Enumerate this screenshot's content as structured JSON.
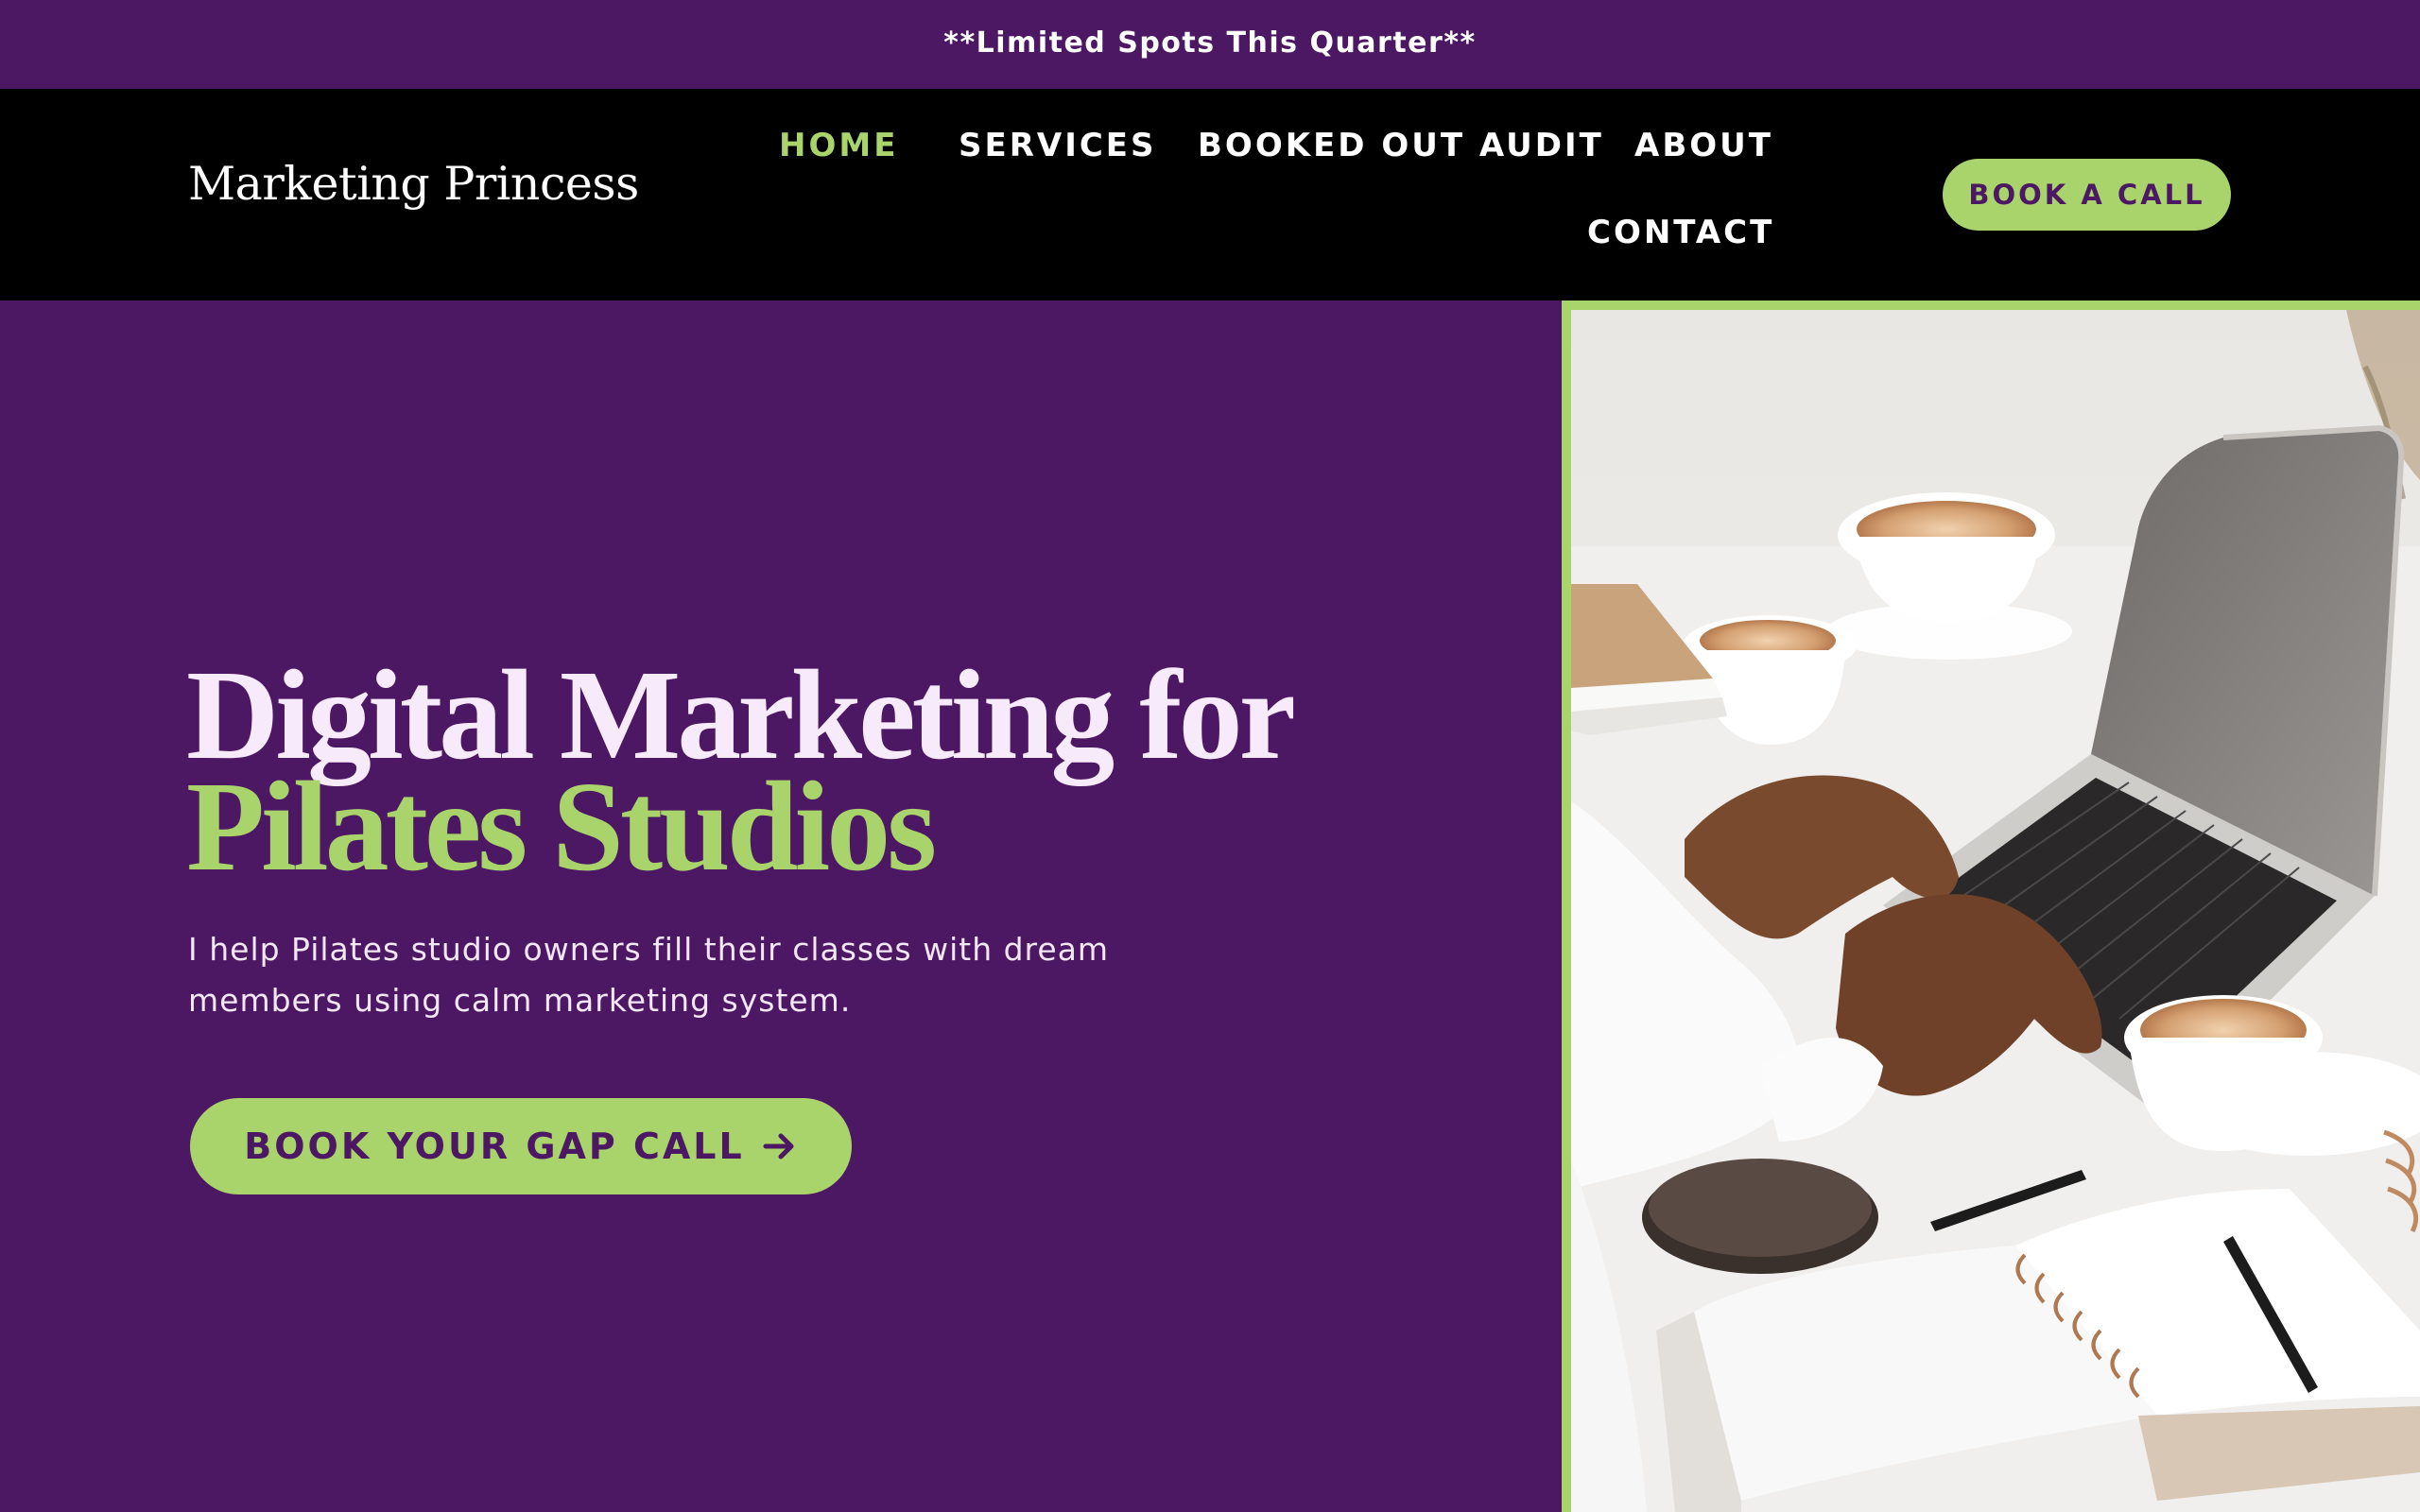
{
  "announcement": {
    "text": "**Limited Spots This Quarter**"
  },
  "header": {
    "logo": "Marketing Princess",
    "nav": [
      {
        "label": "HOME",
        "active": true
      },
      {
        "label": "SERVICES",
        "active": false
      },
      {
        "label": "BOOKED OUT AUDIT",
        "active": false
      },
      {
        "label": "ABOUT",
        "active": false
      },
      {
        "label": "CONTACT",
        "active": false
      }
    ],
    "cta_label": "BOOK A CALL"
  },
  "hero": {
    "title_line1": "Digital Marketing for",
    "title_line2": "Pilates Studios",
    "subtitle": "I help Pilates studio owners fill their classes with dream members using calm marketing system.",
    "cta_label": "BOOK YOUR GAP CALL",
    "cta_icon": "arrow-right-icon",
    "image_subject": "person typing on laptop with coffee cups and notebooks"
  },
  "colors": {
    "brand_purple": "#4d1863",
    "accent_green": "#a9d46b",
    "header_black": "#000000",
    "text_light": "#f7eafa"
  }
}
